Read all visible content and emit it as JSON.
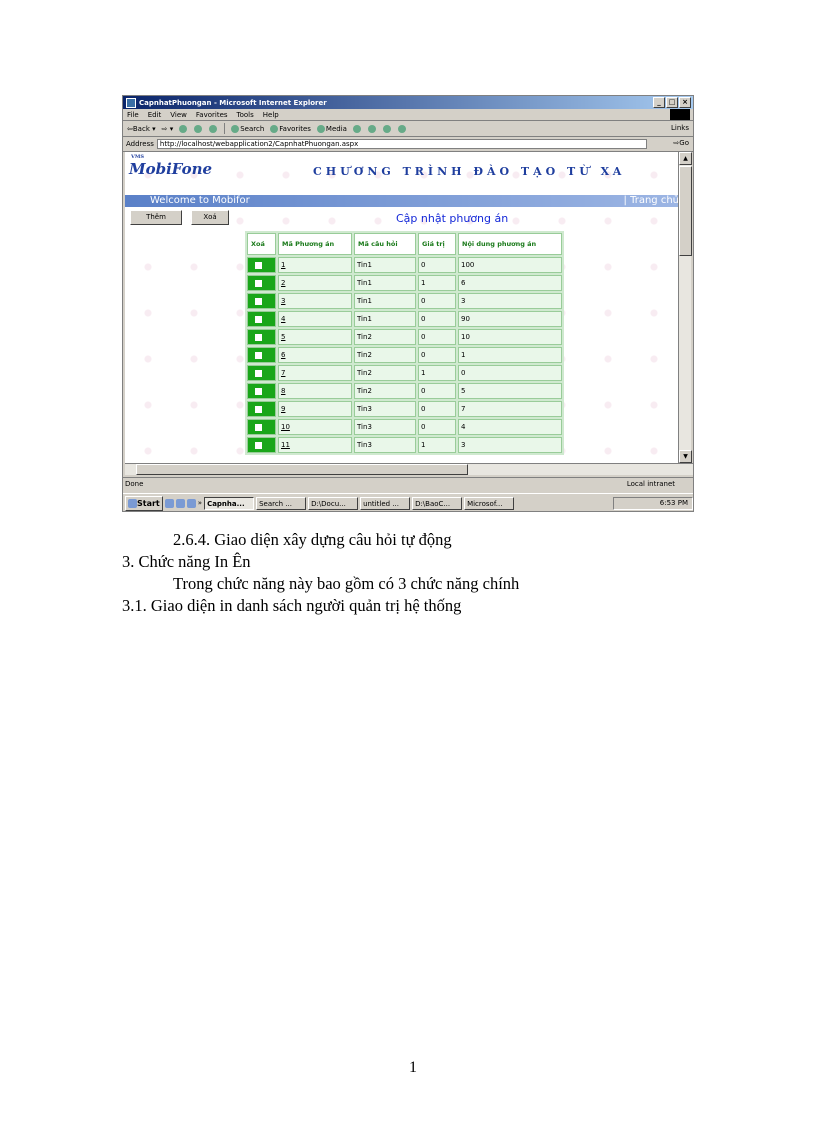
{
  "browser": {
    "title": "CapnhatPhuongan - Microsoft Internet Explorer",
    "menu": [
      "File",
      "Edit",
      "View",
      "Favorites",
      "Tools",
      "Help"
    ],
    "toolbar": {
      "back": "Back",
      "search": "Search",
      "favorites": "Favorites",
      "media": "Media",
      "links": "Links"
    },
    "address_label": "Address",
    "url": "http://localhost/webapplication2/CapnhatPhuongan.aspx",
    "go": "Go",
    "status": "Done",
    "zone": "Local intranet"
  },
  "page": {
    "logo_small": "VMS",
    "logo": "MobiFone",
    "banner_title": "CHƯƠNG TRÌNH ĐÀO TẠO TỪ XA",
    "welcome": "Welcome to Mobifor",
    "home_link": "| Trang chủ",
    "add_button": "Thêm",
    "delete_button": "Xoá",
    "heading": "Cập nhật phương án",
    "table": {
      "headers": [
        "Xoá",
        "Mã Phương án",
        "Mã câu hỏi",
        "Giá trị",
        "Nội dung phương án"
      ],
      "rows": [
        [
          "1",
          "Tin1",
          "0",
          "100"
        ],
        [
          "2",
          "Tin1",
          "1",
          "6"
        ],
        [
          "3",
          "Tin1",
          "0",
          "3"
        ],
        [
          "4",
          "Tin1",
          "0",
          "90"
        ],
        [
          "5",
          "Tin2",
          "0",
          "10"
        ],
        [
          "6",
          "Tin2",
          "0",
          "1"
        ],
        [
          "7",
          "Tin2",
          "1",
          "0"
        ],
        [
          "8",
          "Tin2",
          "0",
          "5"
        ],
        [
          "9",
          "Tin3",
          "0",
          "7"
        ],
        [
          "10",
          "Tin3",
          "0",
          "4"
        ],
        [
          "11",
          "Tin3",
          "1",
          "3"
        ]
      ]
    }
  },
  "taskbar": {
    "start": "Start",
    "items": [
      "Capnha...",
      "Search ...",
      "D:\\Docu...",
      "untitled ...",
      "D:\\BaoC...",
      "Microsof..."
    ],
    "clock": "6:53 PM"
  },
  "document": {
    "line1": "2.6.4. Giao diện xây dựng câu hỏi tự động",
    "line2": "3. Chức năng In Ên",
    "line3": "Trong chức năng này bao gồm có 3 chức năng chính",
    "line4": "3.1. Giao diện in danh sách người quản trị hệ thống",
    "page_number": "1"
  }
}
